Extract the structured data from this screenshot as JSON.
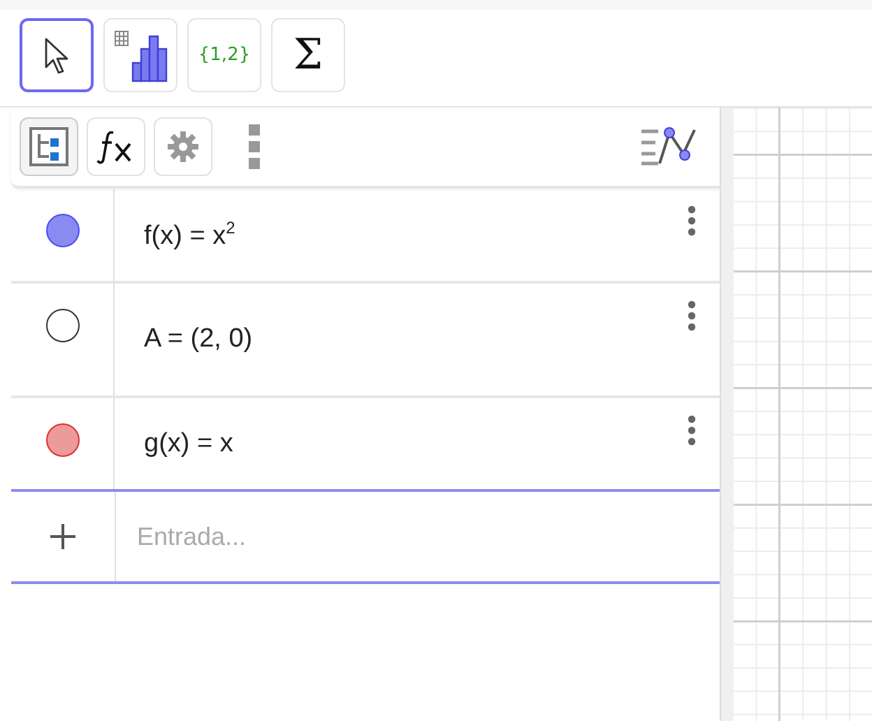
{
  "toolbar": {
    "tools": [
      {
        "kind": "move",
        "selected": true
      },
      {
        "kind": "chart",
        "selected": false
      },
      {
        "kind": "list",
        "label": "{1,2}",
        "selected": false
      },
      {
        "kind": "sum",
        "label": "Σ",
        "selected": false
      }
    ]
  },
  "algebra": {
    "header_buttons": [
      {
        "kind": "tree",
        "selected": true
      },
      {
        "kind": "function",
        "selected": false
      },
      {
        "kind": "settings",
        "selected": false
      }
    ],
    "rows": [
      {
        "expression": "f(x) = x$^{2}$",
        "visible": true,
        "color": "#8a8af0"
      },
      {
        "expression": "A = (2, 0)",
        "visible": false
      },
      {
        "expression": "g(x) = x",
        "visible": true,
        "color": "#ec9a9a"
      }
    ],
    "input": {
      "placeholder": "Entrada..."
    }
  }
}
